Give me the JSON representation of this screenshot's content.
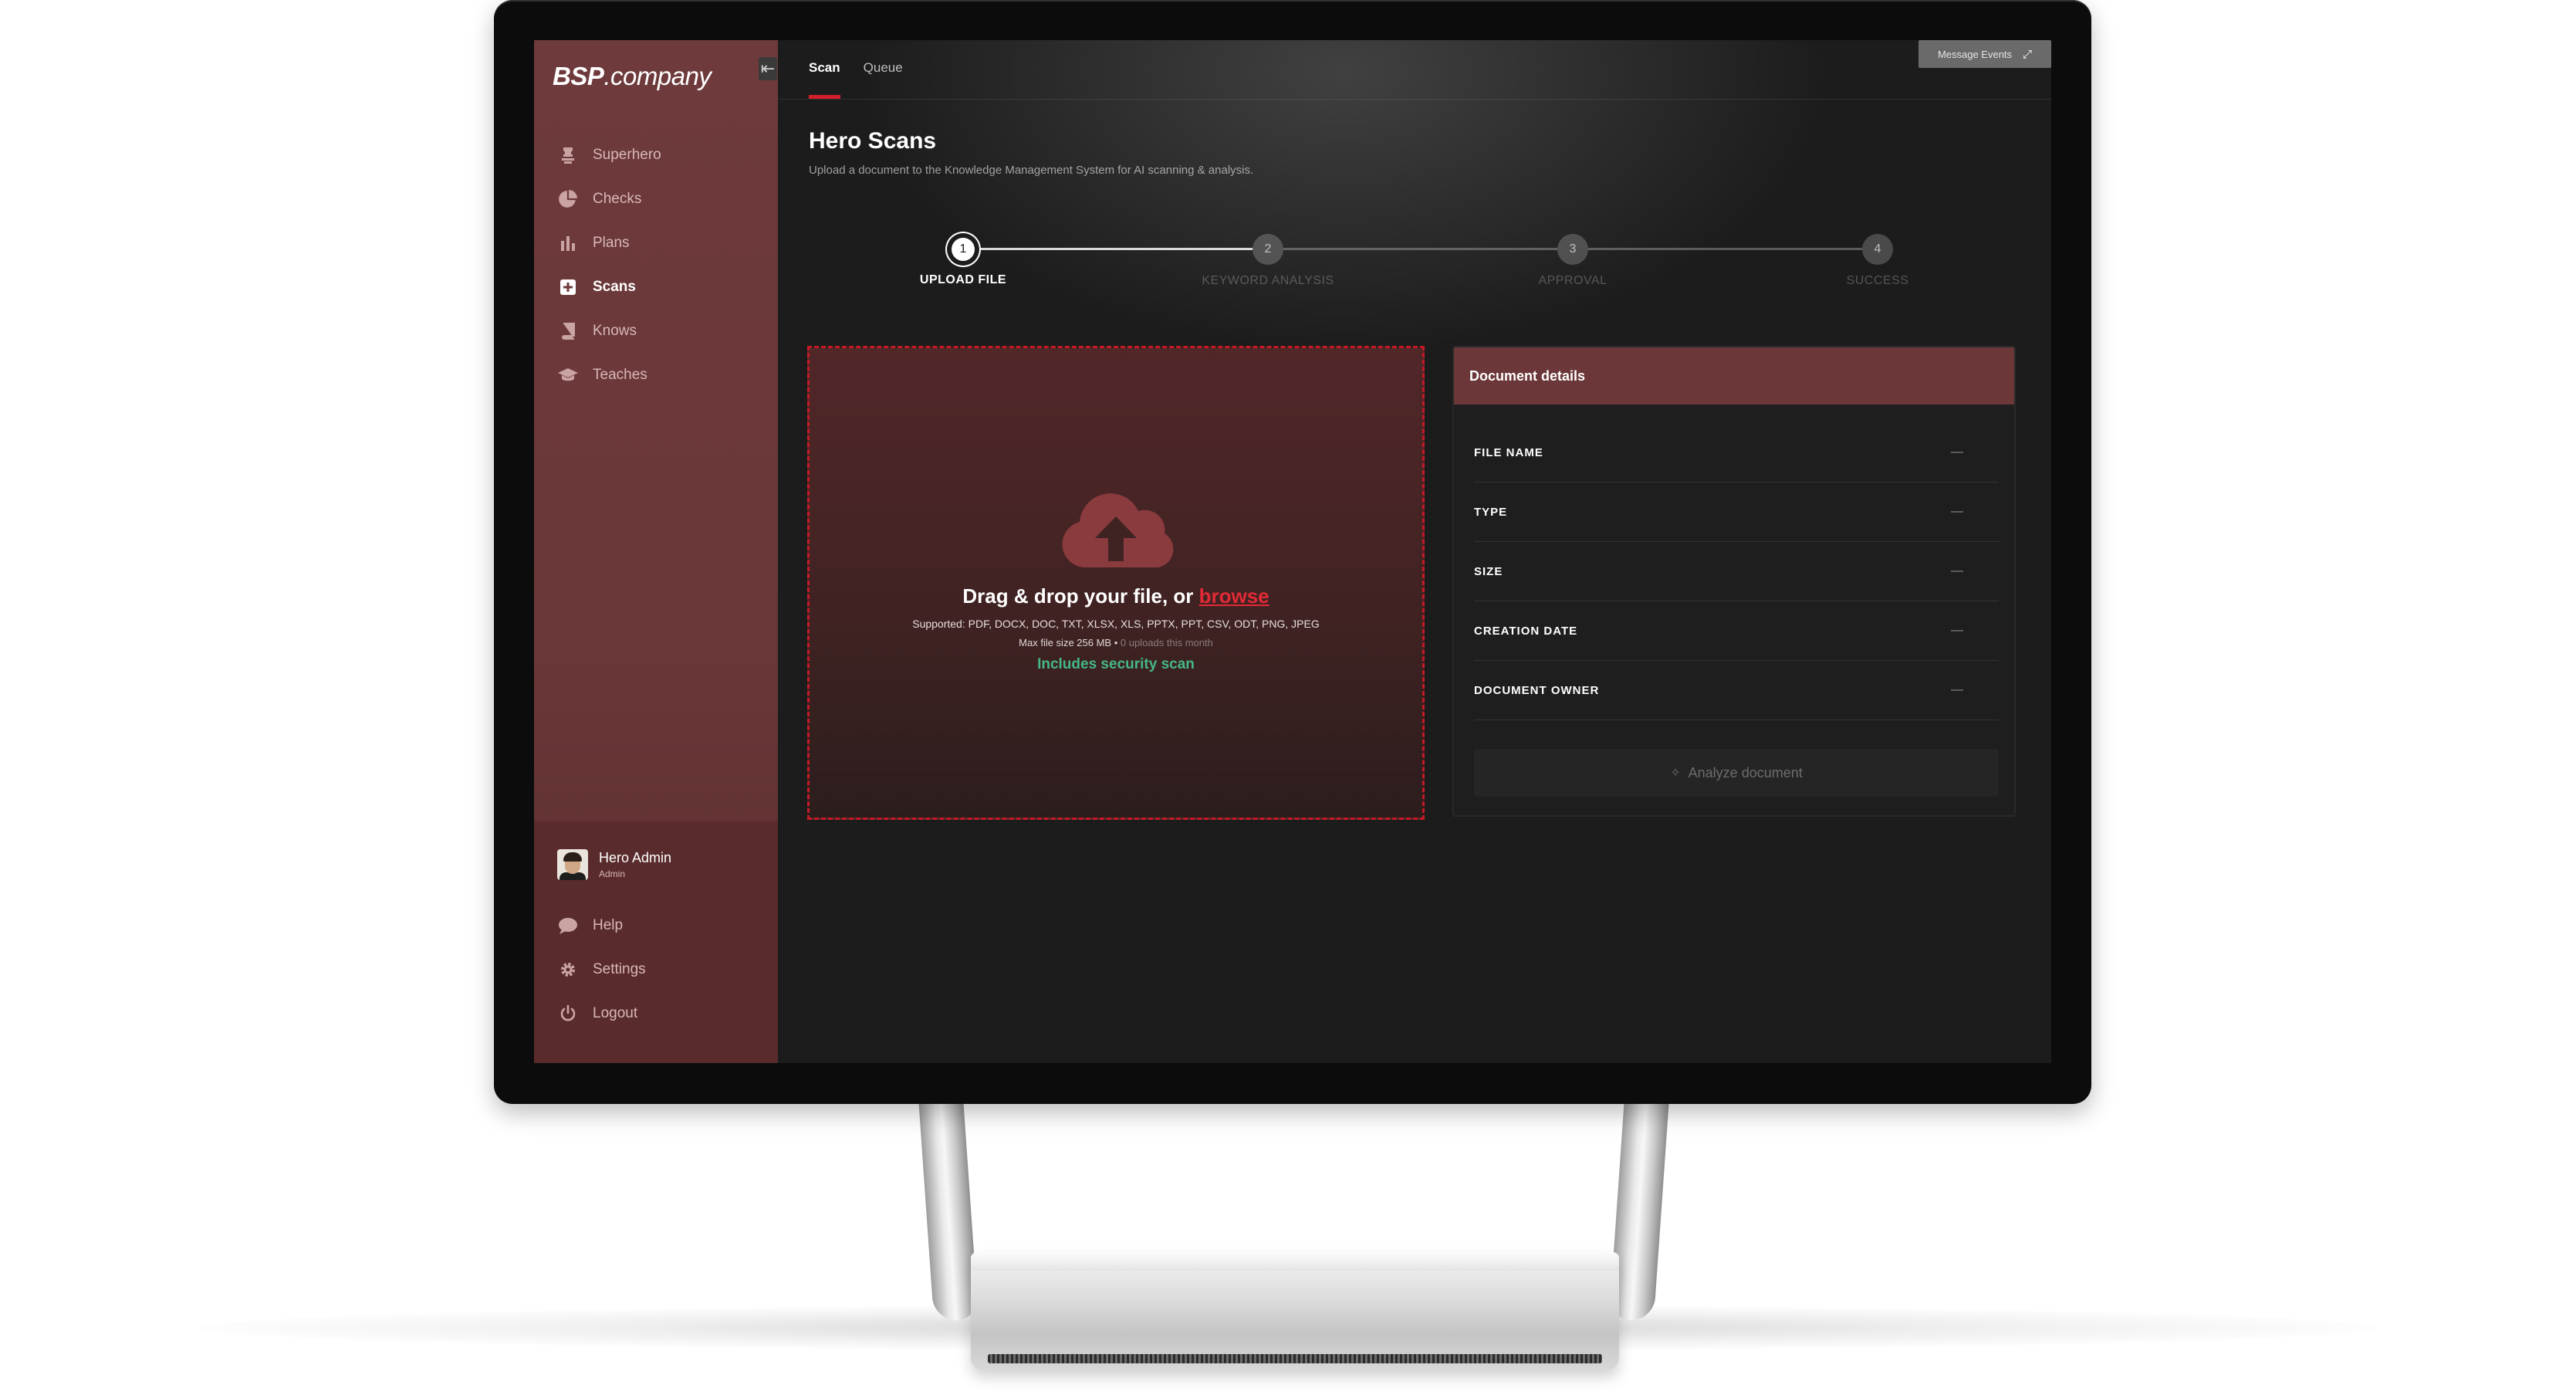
{
  "brand": {
    "bold": "BSP",
    "light": ".company"
  },
  "sidebar": {
    "items": [
      {
        "label": "Superhero",
        "icon": "superhero-icon"
      },
      {
        "label": "Checks",
        "icon": "pie-chart-icon"
      },
      {
        "label": "Plans",
        "icon": "bar-chart-icon"
      },
      {
        "label": "Scans",
        "icon": "plus-square-icon"
      },
      {
        "label": "Knows",
        "icon": "book-icon"
      },
      {
        "label": "Teaches",
        "icon": "graduation-cap-icon"
      }
    ],
    "active": "Scans",
    "user": {
      "name": "Hero Admin",
      "role": "Admin"
    },
    "bottom_items": [
      {
        "label": "Help",
        "icon": "chat-bubble-icon"
      },
      {
        "label": "Settings",
        "icon": "gear-icon"
      },
      {
        "label": "Logout",
        "icon": "power-icon"
      }
    ]
  },
  "header": {
    "tabs": [
      {
        "label": "Scan"
      },
      {
        "label": "Queue"
      }
    ],
    "active_tab": "Scan",
    "message_events_label": "Message Events"
  },
  "page": {
    "title": "Hero Scans",
    "subtitle": "Upload a document to the Knowledge Management System for AI scanning & analysis."
  },
  "stepper": {
    "current": 1,
    "steps": [
      {
        "number": "1",
        "label": "UPLOAD FILE"
      },
      {
        "number": "2",
        "label": "KEYWORD ANALYSIS"
      },
      {
        "number": "3",
        "label": "APPROVAL"
      },
      {
        "number": "4",
        "label": "SUCCESS"
      }
    ]
  },
  "dropzone": {
    "title_prefix": "Drag & drop your file, or ",
    "browse_label": "browse",
    "supported": "Supported: PDF, DOCX, DOC, TXT, XLSX, XLS, PPTX, PPT, CSV, ODT, PNG, JPEG",
    "max_size": "Max file size 256 MB",
    "separator": " • ",
    "uploads_note": "0 uploads this month",
    "security_note": "Includes security scan"
  },
  "details": {
    "title": "Document details",
    "rows": [
      {
        "key": "FILE NAME",
        "value": "—"
      },
      {
        "key": "TYPE",
        "value": "—"
      },
      {
        "key": "SIZE",
        "value": "—"
      },
      {
        "key": "CREATION DATE",
        "value": "—"
      },
      {
        "key": "DOCUMENT OWNER",
        "value": "—"
      }
    ],
    "analyze_label": "Analyze document"
  },
  "colors": {
    "accent_red": "#d31f2a",
    "sidebar": "#6e3a3c",
    "success_green": "#45b885",
    "background": "#1c1c1c"
  }
}
